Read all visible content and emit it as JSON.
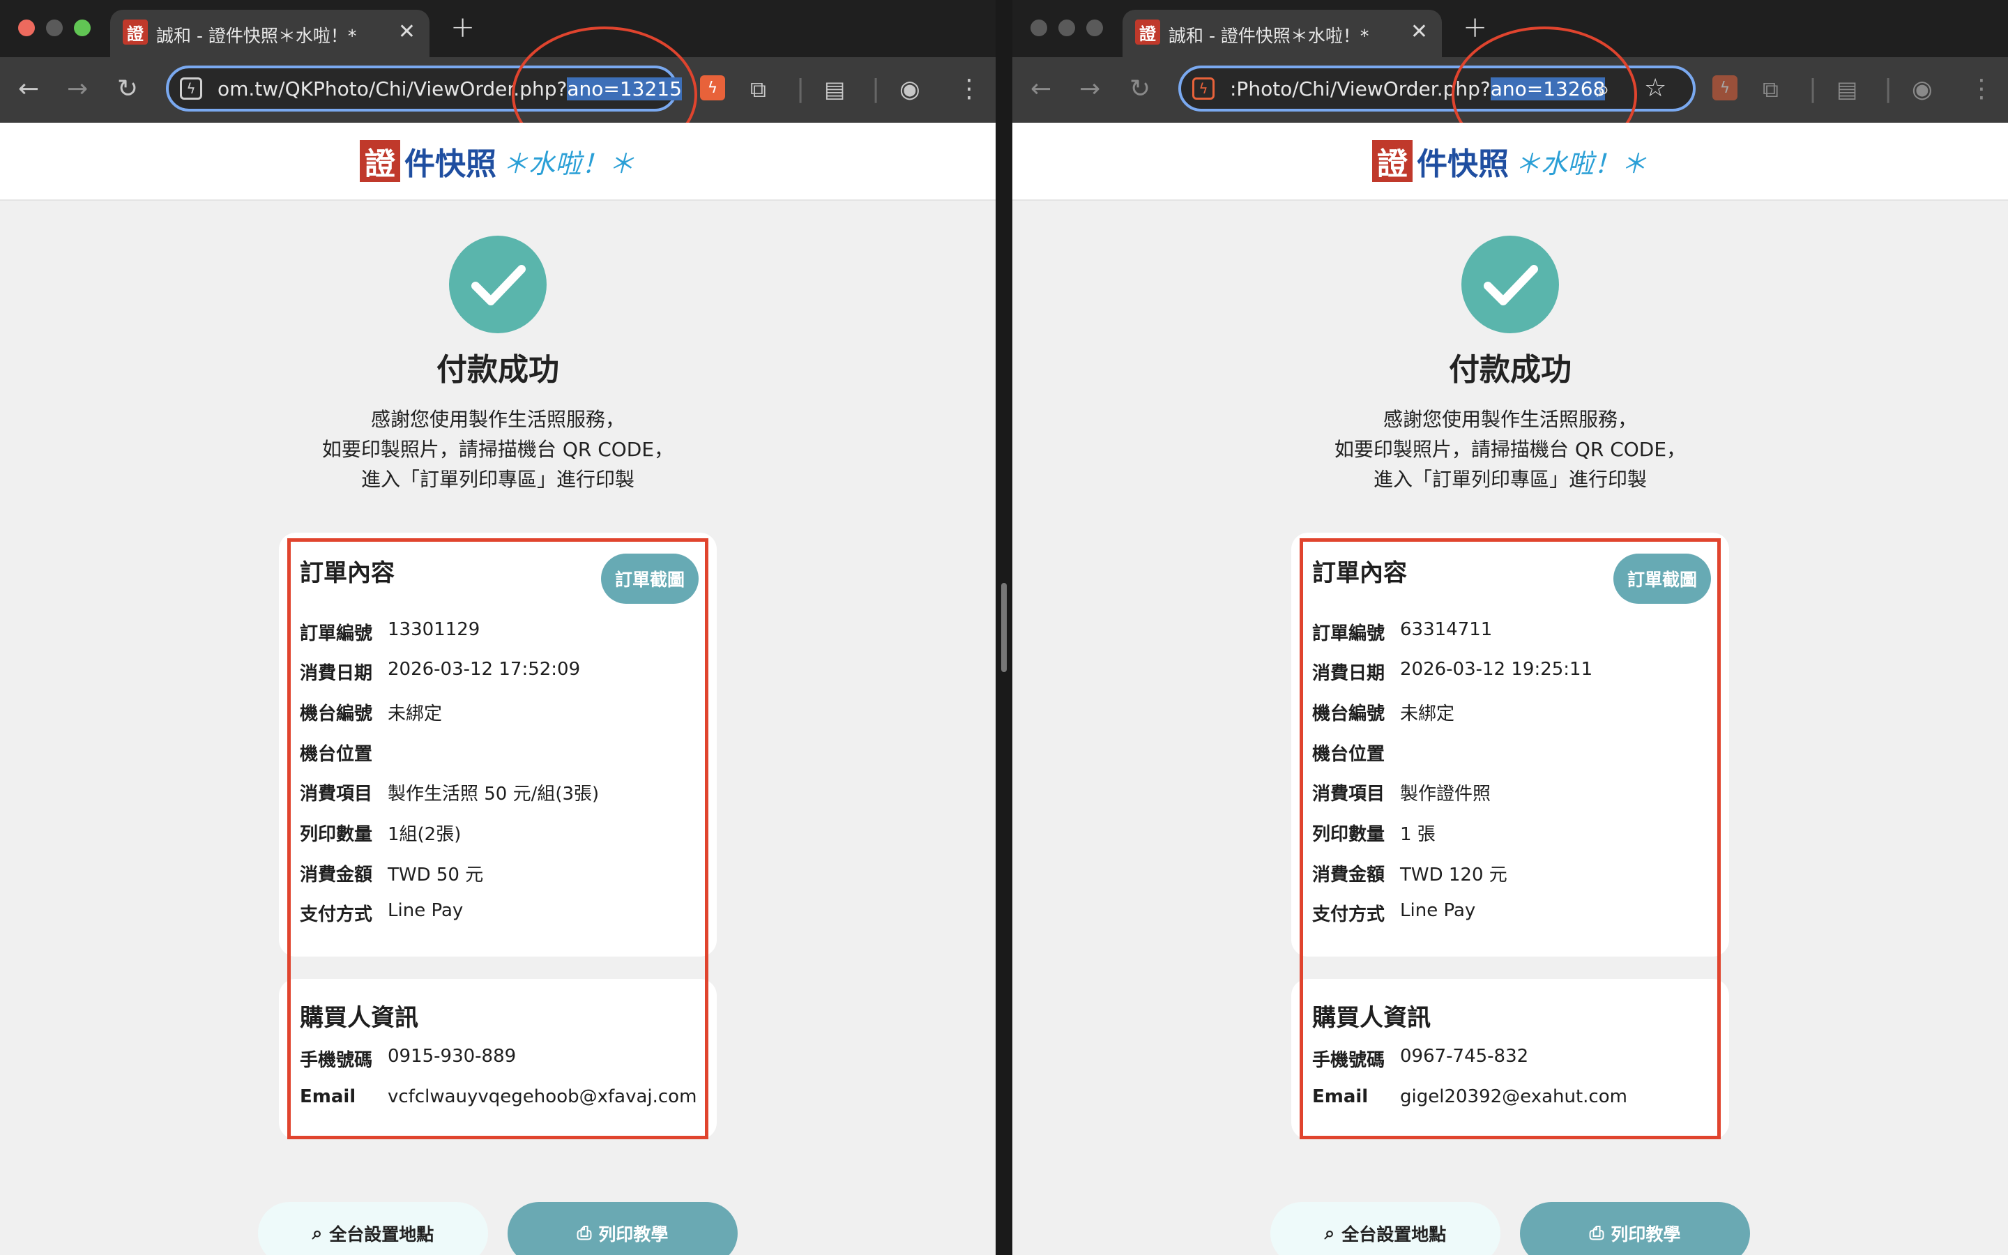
{
  "left": {
    "tab_title": "誠和 - 證件快照＊水啦！*",
    "url_prefix": "om.tw/QKPhoto/Chi/ViewOrder.php?",
    "url_highlight": "ano=13215",
    "order": {
      "section_title": "訂單內容",
      "screenshot_button": "訂單截圖",
      "rows": [
        {
          "label": "訂單編號",
          "value": "13301129"
        },
        {
          "label": "消費日期",
          "value": "2026-03-12 17:52:09"
        },
        {
          "label": "機台編號",
          "value": "未綁定"
        },
        {
          "label": "機台位置",
          "value": ""
        },
        {
          "label": "消費項目",
          "value": "製作生活照 50 元/組(3張)"
        },
        {
          "label": "列印數量",
          "value": "1組(2張)"
        },
        {
          "label": "消費金額",
          "value": "TWD 50 元"
        },
        {
          "label": "支付方式",
          "value": "Line Pay"
        }
      ]
    },
    "buyer": {
      "section_title": "購買人資訊",
      "rows": [
        {
          "label": "手機號碼",
          "value": "0915-930-889"
        },
        {
          "label": "Email",
          "value": "vcfclwauyvqegehoob@xfavaj.com"
        }
      ]
    }
  },
  "right": {
    "tab_title": "誠和 - 證件快照＊水啦！*",
    "url_prefix": ":Photo/Chi/ViewOrder.php?",
    "url_highlight": "ano=13268",
    "order": {
      "section_title": "訂單內容",
      "screenshot_button": "訂單截圖",
      "rows": [
        {
          "label": "訂單編號",
          "value": "63314711"
        },
        {
          "label": "消費日期",
          "value": "2026-03-12 19:25:11"
        },
        {
          "label": "機台編號",
          "value": "未綁定"
        },
        {
          "label": "機台位置",
          "value": ""
        },
        {
          "label": "消費項目",
          "value": "製作證件照"
        },
        {
          "label": "列印數量",
          "value": "1 張"
        },
        {
          "label": "消費金額",
          "value": "TWD 120 元"
        },
        {
          "label": "支付方式",
          "value": "Line Pay"
        }
      ]
    },
    "buyer": {
      "section_title": "購買人資訊",
      "rows": [
        {
          "label": "手機號碼",
          "value": "0967-745-832"
        },
        {
          "label": "Email",
          "value": "gigel20392@exahut.com"
        }
      ]
    }
  },
  "shared": {
    "logo_char": "證",
    "logo_text": "件快照",
    "logo_tagline": "＊水啦！＊",
    "success_title": "付款成功",
    "desc_lines": [
      "感謝您使用製作生活照服務，",
      "如要印製照片，請掃描機台 QR CODE，",
      "進入「訂單列印專區」進行印製"
    ],
    "btn_locations": "全台設置地點",
    "btn_print_tutorial": "列印教學",
    "icons": {
      "favicon": "證",
      "back": "←",
      "forward": "→",
      "reload": "↻",
      "close": "✕",
      "newtab": "+",
      "menu": "⋮",
      "search": "⌕",
      "star": "☆"
    },
    "colors": {
      "accent_teal": "#5ab5ac",
      "button_teal": "#67aab4",
      "annotation_red": "#e0442e",
      "url_highlight": "#3d6fb8"
    }
  }
}
